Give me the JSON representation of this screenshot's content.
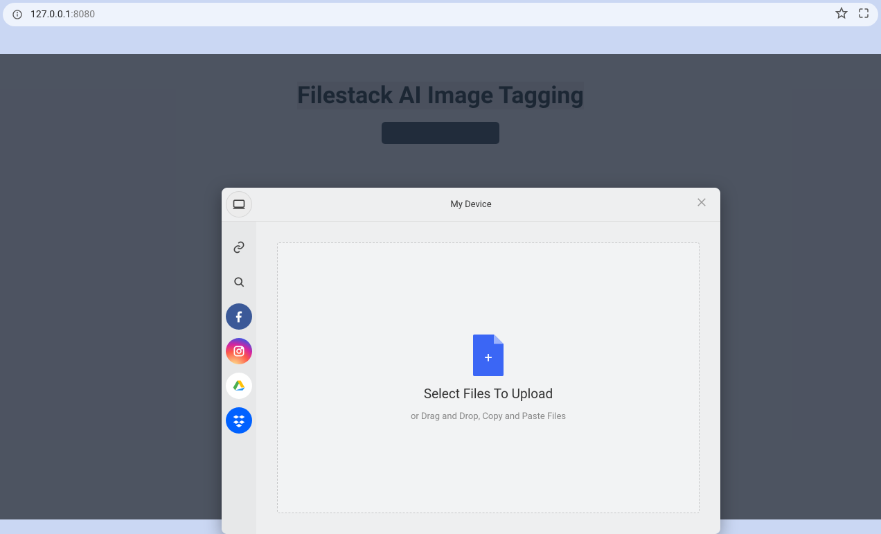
{
  "browser": {
    "host": "127.0.0.1",
    "port": ":8080"
  },
  "page": {
    "title": "Filestack AI Image Tagging"
  },
  "modal": {
    "title": "My Device",
    "dropzone": {
      "headline": "Select Files To Upload",
      "sub": "or Drag and Drop, Copy and Paste Files"
    }
  },
  "sidebar": {
    "items": [
      {
        "name": "my-device"
      },
      {
        "name": "link"
      },
      {
        "name": "search"
      },
      {
        "name": "facebook"
      },
      {
        "name": "instagram"
      },
      {
        "name": "google-drive"
      },
      {
        "name": "dropbox"
      }
    ]
  }
}
